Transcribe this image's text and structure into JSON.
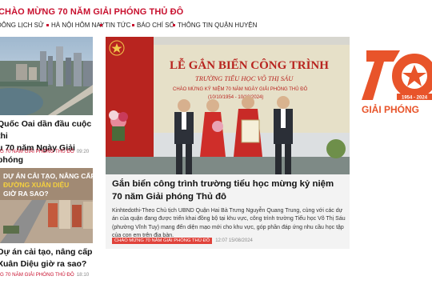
{
  "header": {
    "title": "CHÀO MỪNG 70 NĂM GIẢI PHÓNG THỦ ĐÔ"
  },
  "nav": {
    "items": [
      {
        "label": "ĐÔNG LỊCH SỬ"
      },
      {
        "label": "HÀ NỘI HÔM NAY"
      },
      {
        "label": "TIN TỨC"
      },
      {
        "label": "BÁO CHÍ SỐ"
      },
      {
        "label": "THÔNG TIN QUẬN HUYỆN"
      }
    ]
  },
  "left_articles": [
    {
      "title": "Quốc Oai dần đầu cuộc thi\nu 70 năm Ngày Giải phóng",
      "category": "G 70 NĂM GIẢI PHÓNG THỦ ĐÔ",
      "time": "09:20"
    },
    {
      "title": "Dự án cải tạo, nâng cấp\nXuân Diệu giờ ra sao?",
      "category": "G 70 NĂM GIẢI PHÓNG THỦ ĐÔ",
      "time": "18:10",
      "thumb_overlay": "DỰ ÁN CẢI TẠO, NÂNG CẤP\nĐƯỜNG XUÂN DIỆU\nGIỜ RA SAO?"
    }
  ],
  "featured": {
    "title": "Gắn biển công trình trường tiểu học mừng kỷ niệm 70 năm Giải phóng Thủ đô",
    "summary": "Kinhtedothi-Theo Chủ tịch UBND Quận Hai Bà Trưng Nguyễn Quang Trung, cùng với các dự án của quận đang được triển khai đồng bộ tại khu vực, công trình trường Tiểu học Võ Thị Sáu (phường Vĩnh Tuy) mang đến diện mạo mới cho khu vực, góp phần đáp ứng nhu cầu học tập của con em trên địa bàn.",
    "category": "CHÀO MỪNG 70 NĂM GIẢI PHÓNG THỦ ĐÔ",
    "time": "12:07 15/08/2024",
    "photo_banner": {
      "line1": "LỄ GẮN BIỂN CÔNG TRÌNH",
      "line2": "TRƯỜNG TIỂU HỌC VÕ THỊ SÁU",
      "line3": "CHÀO MỪNG KỶ NIỆM 70 NĂM NGÀY GIẢI PHÓNG THỦ ĐÔ",
      "line4": "(10/10/1954 - 10/10/2024)"
    }
  },
  "logo": {
    "number": "70",
    "years": "1954 - 2024",
    "caption": "GIẢI PHÓNG"
  },
  "colors": {
    "accent": "#c8102e",
    "logo_orange": "#e8542a",
    "badge": "#e0433b"
  }
}
